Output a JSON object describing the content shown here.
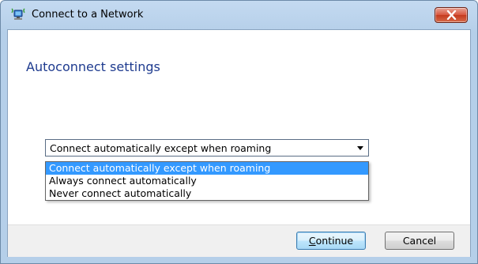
{
  "window": {
    "title": "Connect to a Network"
  },
  "content": {
    "heading": "Autoconnect settings"
  },
  "combo": {
    "selected": "Connect automatically except when roaming",
    "options": [
      "Connect automatically except when roaming",
      "Always connect automatically",
      "Never connect automatically"
    ]
  },
  "buttons": {
    "continue_accel": "C",
    "continue_rest": "ontinue",
    "cancel": "Cancel"
  },
  "colors": {
    "heading": "#1e3b8f",
    "selection": "#3399ff",
    "close_button": "#d8553c"
  },
  "icons": {
    "title": "network-icon",
    "close": "close-icon",
    "combo": "chevron-down-icon"
  }
}
